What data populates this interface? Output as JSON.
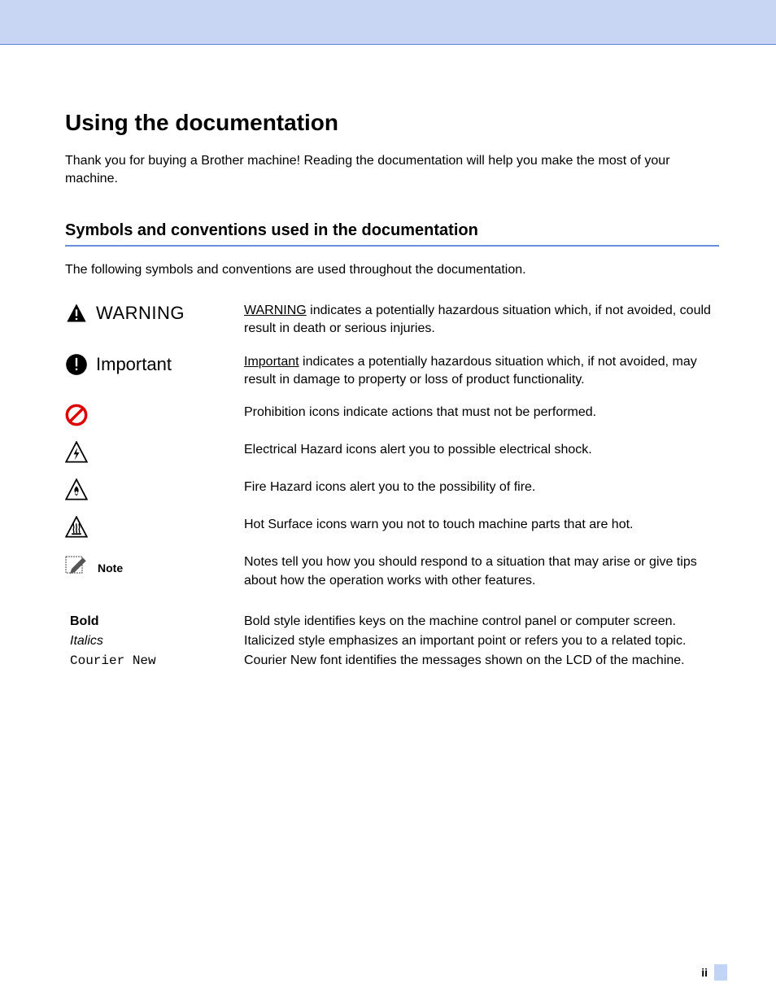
{
  "header": {
    "title": "Using the documentation",
    "intro": "Thank you for buying a Brother machine! Reading the documentation will help you make the most of your machine."
  },
  "section": {
    "title": "Symbols and conventions used in the documentation",
    "lead": "The following symbols and conventions are used throughout the documentation."
  },
  "symbols": {
    "warning": {
      "label": "WARNING",
      "lead": "WARNING",
      "rest": " indicates a potentially hazardous situation which, if not avoided, could result in death or serious injuries."
    },
    "important": {
      "label": "Important",
      "lead": "Important",
      "rest": " indicates a potentially hazardous situation which, if not avoided, may result in damage to property or loss of product functionality."
    },
    "prohibition": {
      "desc": "Prohibition icons indicate actions that must not be performed."
    },
    "electrical": {
      "desc": "Electrical Hazard icons alert you to possible electrical shock."
    },
    "fire": {
      "desc": "Fire Hazard icons alert you to the possibility of fire."
    },
    "hot": {
      "desc": "Hot Surface icons warn you not to touch machine parts that are hot."
    },
    "note": {
      "label": "Note",
      "desc": "Notes tell you how you should respond to a situation that may arise or give tips about how the operation works with other features."
    }
  },
  "styles": {
    "bold": {
      "label": "Bold",
      "desc": "Bold style identifies keys on the machine control panel or computer screen."
    },
    "italics": {
      "label": "Italics",
      "desc": "Italicized style emphasizes an important point or refers you to a related topic."
    },
    "courier": {
      "label": "Courier New",
      "desc": "Courier New font identifies the messages shown on the LCD of the machine."
    }
  },
  "page_number": "ii"
}
